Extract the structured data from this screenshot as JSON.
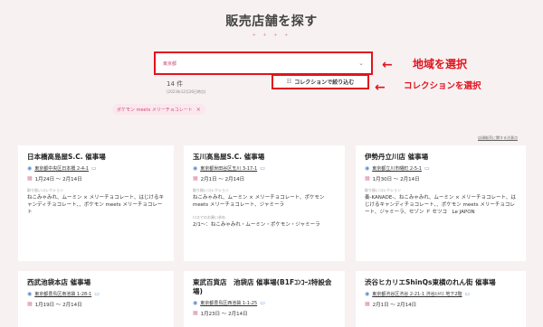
{
  "page": {
    "title": "販売店舗を探す",
    "dots": "+ + + +"
  },
  "region_select": {
    "value": "東京都",
    "chevron": "⌄"
  },
  "annotations": {
    "region": "地域を選択",
    "collection": "コレクションを選択",
    "arrow": "←"
  },
  "results": {
    "count": "14 件",
    "updated": "(2023年12月26日時点)"
  },
  "filter": {
    "label": "コレクションで絞り込む",
    "icon": "sliders-icon"
  },
  "chip": {
    "label": "ポケモン meets メリーチョコレート",
    "close": "×"
  },
  "notice_link": "店頭販売に関する注意点",
  "labels": {
    "collection": "取り扱いコレクション",
    "note": "ロスでのお買い求め"
  },
  "cards": [
    {
      "title": "日本橋高島屋S.C. 催事場",
      "address": "東京都中央区日本橋 2-4-1",
      "dates": "1月24日 〜 2月14日",
      "collection": "ねこみゃみれ、ムーミン × メリーチョコレート、はじけるキャンディチョコレート、、ポケモン meets メリーチョコレート",
      "note": ""
    },
    {
      "title": "玉川髙島屋S.C. 催事場",
      "address": "東京都世田谷区玉川 3-17-1",
      "dates": "2月1日 〜 2月14日",
      "collection": "ねこみゃみれ、ムーミン × メリーチョコレート、ポケモン meets メリーチョコレート、ジャミーラ",
      "note": "2/1〜：ねこみゃみれ・ムーミン・ポケモン・ジャミーラ"
    },
    {
      "title": "伊勢丹立川店 催事場",
      "address": "東京都立川市曙町 2-5-1",
      "dates": "1月30日 〜 2月14日",
      "collection": "奏-KANADE-、ねこみゃみれ、ムーミン × メリーチョコレート、はじけるキャンディチョコレート、、ポケモン meets メリーチョコレート、ジャミーラ、セゾン ド セツコ　Le JAPON",
      "note": ""
    },
    {
      "title": "西武池袋本店 催事場",
      "address": "東京都豊島区南池袋 1-28-1",
      "dates": "1月19日 〜 2月14日",
      "collection": "",
      "note": ""
    },
    {
      "title": "東武百貨店　池袋店 催事場(B1Fｺﾝｺｰｽ特設会場)",
      "address": "東京都豊島区西池袋 1-1-25",
      "dates": "1月23日 〜 2月14日",
      "collection": "",
      "note": ""
    },
    {
      "title": "渋谷ヒカリエShinQs東横のれん街 催事場",
      "address": "東京都渋谷区渋谷 2-21-1 渋谷ﾋｶﾘｴ 地下2階",
      "dates": "2月1日 〜 2月14日",
      "collection": "",
      "note": ""
    }
  ],
  "colors": {
    "background": "#f7f1f2",
    "accent": "#d04a7a",
    "highlight": "#e0141e",
    "location_icon": "#5a8fd0"
  }
}
